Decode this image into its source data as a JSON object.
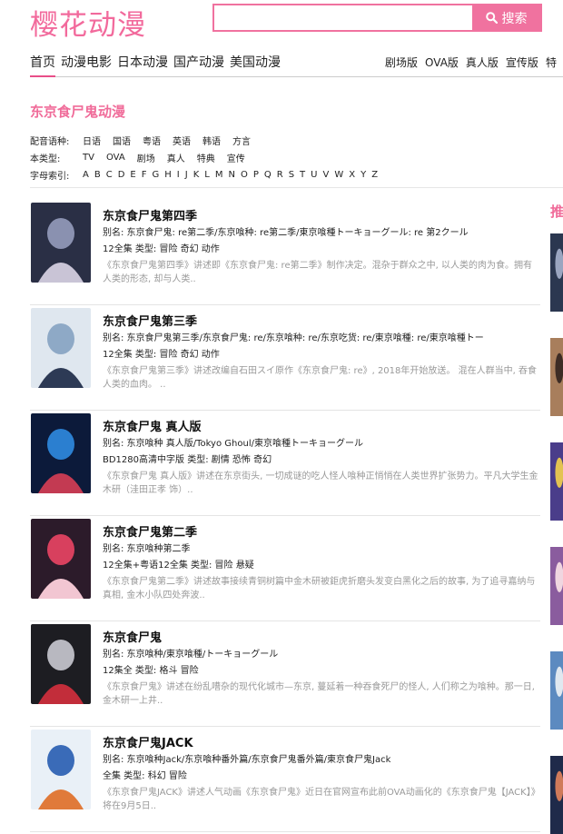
{
  "header": {
    "logo": "樱花动漫",
    "search_placeholder": "",
    "search_button": "搜索"
  },
  "nav": {
    "main": [
      "首页",
      "动漫电影",
      "日本动漫",
      "国产动漫",
      "美国动漫"
    ],
    "active": 0,
    "sub": [
      "剧场版",
      "OVA版",
      "真人版",
      "宣传版",
      "特"
    ]
  },
  "section_title": "东京食尸鬼动漫",
  "filters": [
    {
      "label": "配音语种:",
      "options": [
        "日语",
        "国语",
        "粤语",
        "英语",
        "韩语",
        "方言"
      ]
    },
    {
      "label": "本类型:",
      "options": [
        "TV",
        "OVA",
        "剧场",
        "真人",
        "特典",
        "宣传"
      ]
    },
    {
      "label": "字母索引:",
      "options": [
        "A",
        "B",
        "C",
        "D",
        "E",
        "F",
        "G",
        "H",
        "I",
        "J",
        "K",
        "L",
        "M",
        "N",
        "O",
        "P",
        "Q",
        "R",
        "S",
        "T",
        "U",
        "V",
        "W",
        "X",
        "Y",
        "Z"
      ]
    }
  ],
  "items": [
    {
      "title": "东京食尸鬼第四季",
      "alias": "别名: 东京食尸鬼: re第二季/东京喰种: re第二季/東京喰種トーキョーグール: re 第2クール",
      "meta": "12全集   类型: 冒险 奇幻 动作",
      "desc": "《东京食尸鬼第四季》讲述即《东京食尸鬼: re第二季》制作决定。混杂于群众之中, 以人类的肉为食。拥有人类的形态, 却与人类..",
      "thumb_colors": [
        "#2a2f45",
        "#8a91b0",
        "#c9c4d6"
      ]
    },
    {
      "title": "东京食尸鬼第三季",
      "alias": "别名: 东京食尸鬼第三季/东京食尸鬼: re/东京喰种: re/东京吃货: re/東京喰種: re/東京喰種トー",
      "meta": "12全集   类型: 冒险 奇幻 动作",
      "desc": "《东京食尸鬼第三季》讲述改编自石田スイ原作《东京食尸鬼: re》, 2018年开始放送。 混在人群当中, 吞食人类的血肉。 ..",
      "thumb_colors": [
        "#dfe7ef",
        "#8ea9c6",
        "#2d3a55"
      ]
    },
    {
      "title": "东京食尸鬼 真人版",
      "alias": "别名: 东京喰种 真人版/Tokyo Ghoul/東京喰種トーキョーグール",
      "meta": "BD1280高清中字版   类型: 剧情 恐怖 奇幻",
      "desc": "《东京食尸鬼 真人版》讲述在东京街头, 一切成谜的吃人怪人喰种正悄悄在人类世界扩张势力。平凡大学生金木研（洼田正孝 饰）..",
      "thumb_colors": [
        "#0c1a3a",
        "#2b7fd0",
        "#c33a52"
      ]
    },
    {
      "title": "东京食尸鬼第二季",
      "alias": "别名: 东京喰种第二季",
      "meta": "12全集+粤语12全集   类型: 冒险 悬疑",
      "desc": "《东京食尸鬼第二季》讲述故事接续青铜树篇中金木研被鉅虎折磨头发变白黑化之后的故事, 为了追寻嘉纳与真相, 金木小队四处奔波..",
      "thumb_colors": [
        "#2c1b2a",
        "#d8405e",
        "#f2c6d2"
      ]
    },
    {
      "title": "东京食尸鬼",
      "alias": "别名: 东京喰种/東京喰種/トーキョーグール",
      "meta": "12集全   类型: 格斗 冒险",
      "desc": "《东京食尸鬼》讲述在纷乱嘈杂的现代化城市—东京, 蔓延着一种吞食死尸的怪人, 人们称之为喰种。那一日, 金木研一上井..",
      "thumb_colors": [
        "#1d1d22",
        "#b8b8c0",
        "#c22d3a"
      ]
    },
    {
      "title": "东京食尸鬼JACK",
      "alias": "别名: 东京喰种Jack/东京喰种番外篇/东京食尸鬼番外篇/東京食尸鬼Jack",
      "meta": "全集   类型: 科幻 冒险",
      "desc": "《东京食尸鬼JACK》讲述人气动画《东京食尸鬼》近日在官网宣布此前OVA动画化的《东京食尸鬼【JACK】》将在9月5日..",
      "thumb_colors": [
        "#e9f0f7",
        "#3a6bb8",
        "#e07a3a"
      ]
    }
  ],
  "sidebar": {
    "title": "推",
    "thumb_colors": [
      [
        "#2b3750",
        "#9aa5c0"
      ],
      [
        "#a87e5c",
        "#3d2c25"
      ],
      [
        "#4a3d8a",
        "#e3c352"
      ],
      [
        "#8a5c9e",
        "#f0d6e0"
      ],
      [
        "#5c8ac0",
        "#e0e8f0"
      ],
      [
        "#1f2a4a",
        "#d07a5a"
      ]
    ]
  },
  "colors": {
    "accent": "#f0729f",
    "title_pink": "#f06b99"
  }
}
